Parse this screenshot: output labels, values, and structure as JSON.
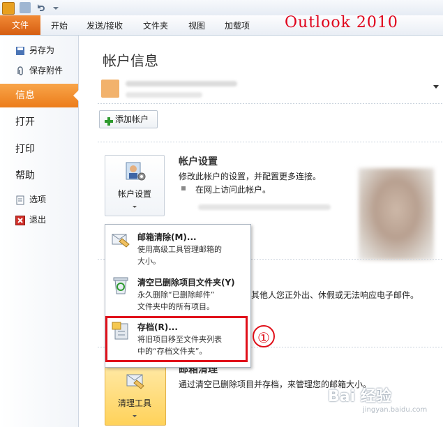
{
  "ribbon": {
    "file_tab": "文件",
    "tabs": [
      "开始",
      "发送/接收",
      "文件夹",
      "视图",
      "加载项"
    ],
    "annotation": "Outlook 2010"
  },
  "nav": {
    "save_as": "另存为",
    "save_attachments": "保存附件",
    "info": "信息",
    "open": "打开",
    "print": "打印",
    "help": "帮助",
    "options": "选项",
    "exit": "退出"
  },
  "main": {
    "title": "帐户信息",
    "add_account": "添加帐户",
    "account_settings": {
      "button_label": "帐户设置",
      "heading": "帐户设置",
      "description": "修改此帐户的设置，并配置更多连接。",
      "bullet": "在网上访问此帐户。"
    },
    "partial_text": "其他人您正外出、休假或无法响应电子邮件。",
    "cleanup": {
      "button_label": "清理工具",
      "heading": "邮箱清理",
      "description": "通过清空已删除项目并存档，来管理您的邮箱大小。"
    }
  },
  "menu": {
    "items": [
      {
        "title": "邮箱清除(M)...",
        "desc1": "使用高级工具管理邮箱的",
        "desc2": "大小。"
      },
      {
        "title": "清空已删除项目文件夹(Y)",
        "desc1": "永久删除“已删除邮件”",
        "desc2": "文件夹中的所有项目。"
      },
      {
        "title": "存档(R)...",
        "desc1": "将旧项目移至文件夹列表",
        "desc2": "中的“存档文件夹”。"
      }
    ],
    "marker": "①"
  },
  "watermark": {
    "main": "Bai 经验",
    "sub": "jingyan.baidu.com"
  },
  "colors": {
    "file_tab": "#d65e12",
    "nav_selected": "#ec7c1a",
    "highlight": "#e0101a"
  }
}
